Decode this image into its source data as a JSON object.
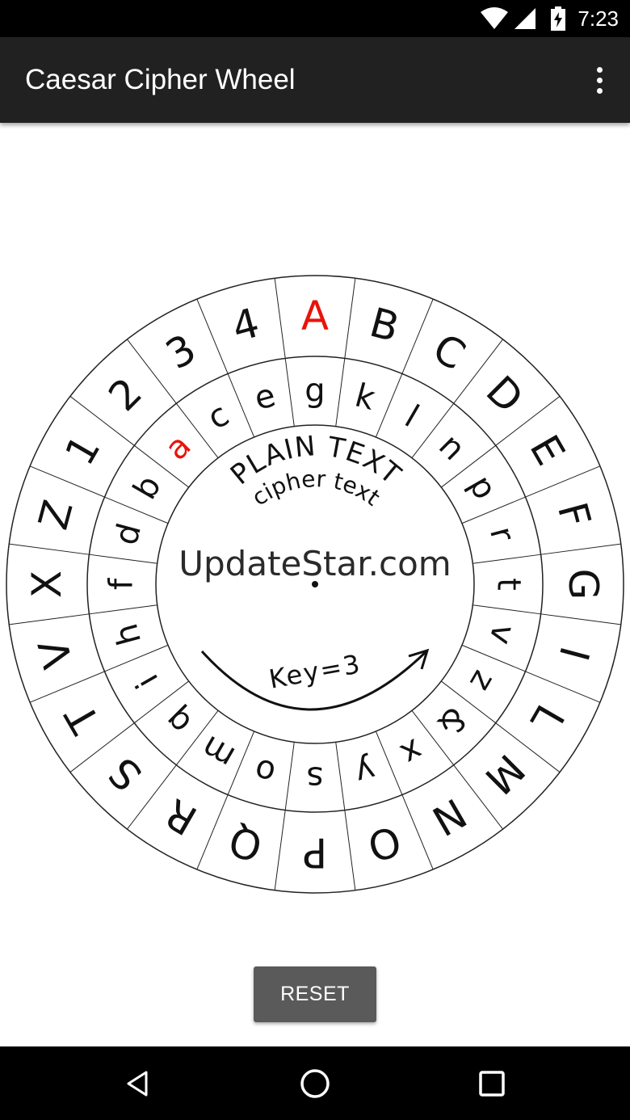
{
  "status_bar": {
    "time": "7:23"
  },
  "app_bar": {
    "title": "Caesar Cipher Wheel",
    "menu_icon": "more-vert-icon"
  },
  "wheel": {
    "outer_ring": [
      "A",
      "B",
      "C",
      "D",
      "E",
      "F",
      "G",
      "I",
      "L",
      "M",
      "N",
      "O",
      "P",
      "Q",
      "R",
      "S",
      "T",
      "V",
      "X",
      "Z",
      "1",
      "2",
      "3",
      "4"
    ],
    "inner_ring": [
      "g",
      "k",
      "l",
      "n",
      "p",
      "r",
      "t",
      "v",
      "z",
      "&",
      "x",
      "y",
      "s",
      "o",
      "m",
      "q",
      "i",
      "h",
      "f",
      "d",
      "b",
      "a",
      "c",
      "e"
    ],
    "plain_label": "PLAIN TEXT",
    "cipher_label": "cipher text",
    "watermark": "UpdateStar.com",
    "key_label": "Key=3",
    "highlight_color": "#e8140a",
    "highlight_outer": "A",
    "highlight_inner": "a"
  },
  "reset_button": {
    "label": "RESET"
  },
  "nav_bar": {
    "back": "back-icon",
    "home": "home-icon",
    "recents": "recents-icon"
  }
}
